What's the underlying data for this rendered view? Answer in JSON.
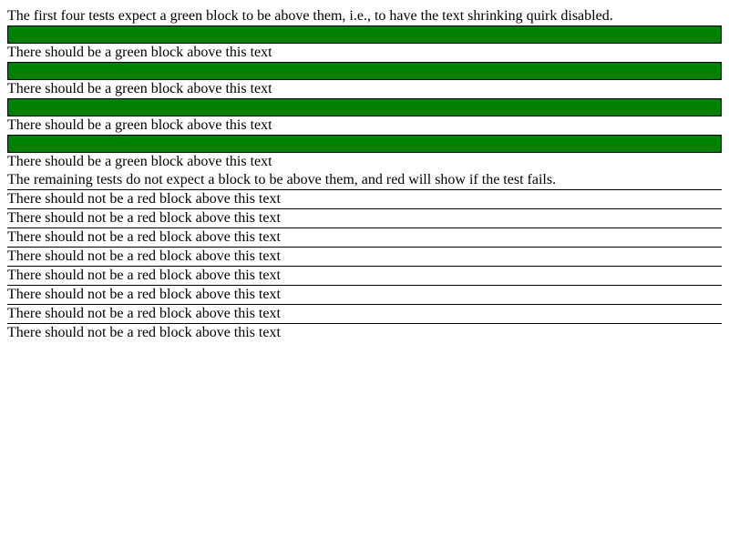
{
  "intro_green": "The first four tests expect a green block to be above them, i.e., to have the text shrinking quirk disabled.",
  "green_tests": [
    {
      "text": "There should be a green block above this text"
    },
    {
      "text": "There should be a green block above this text"
    },
    {
      "text": "There should be a green block above this text"
    },
    {
      "text": "There should be a green block above this text"
    }
  ],
  "intro_red": "The remaining tests do not expect a block to be above them, and red will show if the test fails.",
  "red_tests": [
    {
      "text": "There should not be a red block above this text"
    },
    {
      "text": "There should not be a red block above this text"
    },
    {
      "text": "There should not be a red block above this text"
    },
    {
      "text": "There should not be a red block above this text"
    },
    {
      "text": "There should not be a red block above this text"
    },
    {
      "text": "There should not be a red block above this text"
    },
    {
      "text": "There should not be a red block above this text"
    },
    {
      "text": "There should not be a red block above this text"
    }
  ],
  "colors": {
    "pass_block": "#008000",
    "fail_block": "#ff0000",
    "border": "#000000"
  }
}
